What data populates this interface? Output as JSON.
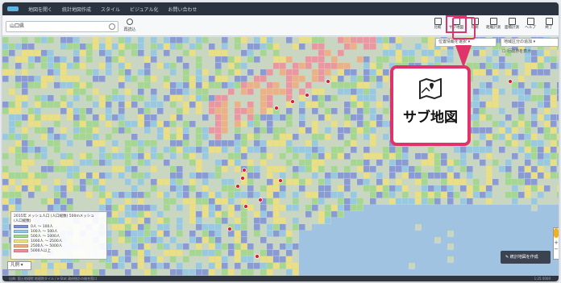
{
  "menubar": {
    "items": [
      "地図を開く",
      "統計地図作成",
      "スタイル",
      "ビジュアル化",
      "お問い合わせ"
    ]
  },
  "toolbar": {
    "search_value": "山口県",
    "left_tool_label": "再読込",
    "right_tools": [
      {
        "name": "save-tool",
        "label": "比較"
      },
      {
        "name": "sub-map-tool",
        "label": "サブ地図"
      },
      {
        "name": "print-tool",
        "label": "印刷"
      },
      {
        "name": "measure-tool",
        "label": "距離計測"
      },
      {
        "name": "area-tool",
        "label": "面積計測"
      },
      {
        "name": "help-tool",
        "label": "ヘルプ"
      },
      {
        "name": "exit-tool",
        "label": "終了"
      }
    ]
  },
  "map": {
    "dropdown1": "位置情報を選択",
    "dropdown2": "地域区分の追加",
    "check_label": "行政界を表示"
  },
  "legend": {
    "title": "2015年 メッシュ人口 (人口総数) 500mメッシュ",
    "title2": "(人口総数)",
    "items": [
      {
        "label": "0人 〜 100人",
        "color": "#7f8fd6"
      },
      {
        "label": "100人 〜 500人",
        "color": "#8fc7e6"
      },
      {
        "label": "500人 〜 1000人",
        "color": "#9fd78a"
      },
      {
        "label": "1000人 〜 2500人",
        "color": "#f1e07a"
      },
      {
        "label": "2500人 〜 5000人",
        "color": "#f2ab7c"
      },
      {
        "label": "5000人以上",
        "color": "#ee8d9c"
      }
    ]
  },
  "scale_button": "凡例 ▾",
  "sub_map_button": "統計地図を作成",
  "statusbar": {
    "left": "出典: 国土地理院 地理院タイル / e-Stat 政府統計の総合窓口",
    "right": "1:25 0000"
  },
  "callout": {
    "label": "サブ地図",
    "icon": "map-pin-icon"
  }
}
